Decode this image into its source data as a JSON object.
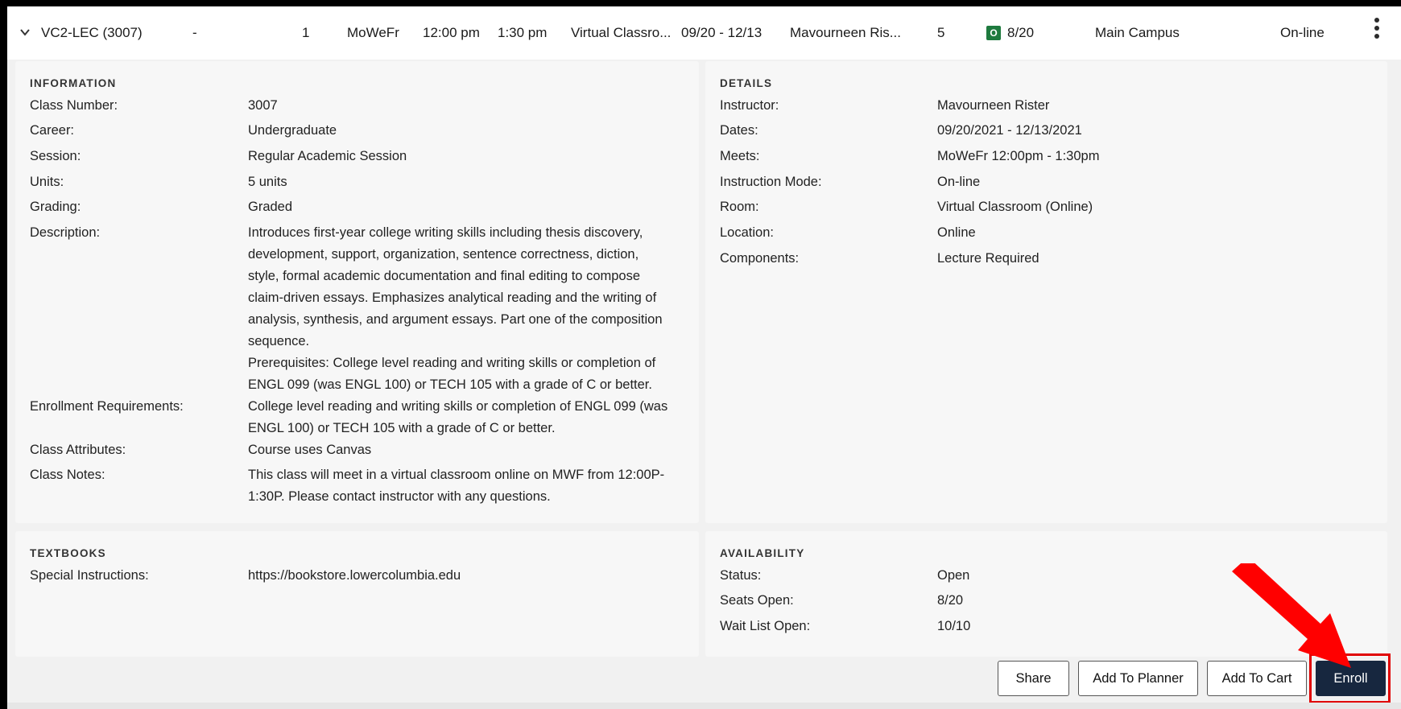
{
  "section_row": {
    "section": "VC2-LEC (3007)",
    "dash": "-",
    "session": "1",
    "days": "MoWeFr",
    "start": "12:00 pm",
    "end": "1:30 pm",
    "room": "Virtual Classro...",
    "dates": "09/20 - 12/13",
    "instructor": "Mavourneen Ris...",
    "units": "5",
    "status_badge": "O",
    "seats": "8/20",
    "campus": "Main Campus",
    "mode": "On-line"
  },
  "information": {
    "title": "INFORMATION",
    "class_number_label": "Class Number:",
    "class_number": "3007",
    "career_label": "Career:",
    "career": "Undergraduate",
    "session_label": "Session:",
    "session": "Regular Academic Session",
    "units_label": "Units:",
    "units": "5 units",
    "grading_label": "Grading:",
    "grading": "Graded",
    "description_label": "Description:",
    "description_lines": [
      "Introduces first-year college writing skills including thesis discovery,",
      "development, support, organization, sentence correctness, diction,",
      "style, formal academic documentation and final editing to compose",
      "claim-driven essays. Emphasizes analytical reading and the writing of",
      "analysis, synthesis, and argument essays. Part one of the composition",
      "sequence.",
      "Prerequisites: College level reading and writing skills or completion of",
      "ENGL 099 (was ENGL 100) or TECH 105 with a grade of C or better."
    ],
    "enrollment_req_label": "Enrollment Requirements:",
    "enrollment_req_lines": [
      "College level reading and writing skills or completion of ENGL 099 (was",
      "ENGL 100) or TECH 105 with a grade of C or better."
    ],
    "attributes_label": "Class Attributes:",
    "attributes": "Course uses Canvas",
    "notes_label": "Class Notes:",
    "notes_lines": [
      "This class will meet in a virtual classroom online on MWF from 12:00P-",
      "1:30P. Please contact instructor with any questions."
    ]
  },
  "details": {
    "title": "DETAILS",
    "instructor_label": "Instructor:",
    "instructor": "Mavourneen Rister",
    "dates_label": "Dates:",
    "dates": "09/20/2021 - 12/13/2021",
    "meets_label": "Meets:",
    "meets": "MoWeFr 12:00pm - 1:30pm",
    "mode_label": "Instruction Mode:",
    "mode": "On-line",
    "room_label": "Room:",
    "room": "Virtual Classroom (Online)",
    "location_label": "Location:",
    "location": "Online",
    "components_label": "Components:",
    "components": "Lecture Required"
  },
  "textbooks": {
    "title": "TEXTBOOKS",
    "special_label": "Special Instructions:",
    "special": "https://bookstore.lowercolumbia.edu"
  },
  "availability": {
    "title": "AVAILABILITY",
    "status_label": "Status:",
    "status": "Open",
    "seats_label": "Seats Open:",
    "seats": "8/20",
    "waitlist_label": "Wait List Open:",
    "waitlist": "10/10"
  },
  "actions": {
    "share": "Share",
    "planner": "Add To Planner",
    "cart": "Add To Cart",
    "enroll": "Enroll"
  },
  "colors": {
    "enroll_bg": "#17273f",
    "highlight": "#e00000",
    "open_badge": "#1e7a3e"
  },
  "icons": [
    "chevron-down-icon",
    "more-vertical-icon",
    "red-arrow-annotation"
  ]
}
